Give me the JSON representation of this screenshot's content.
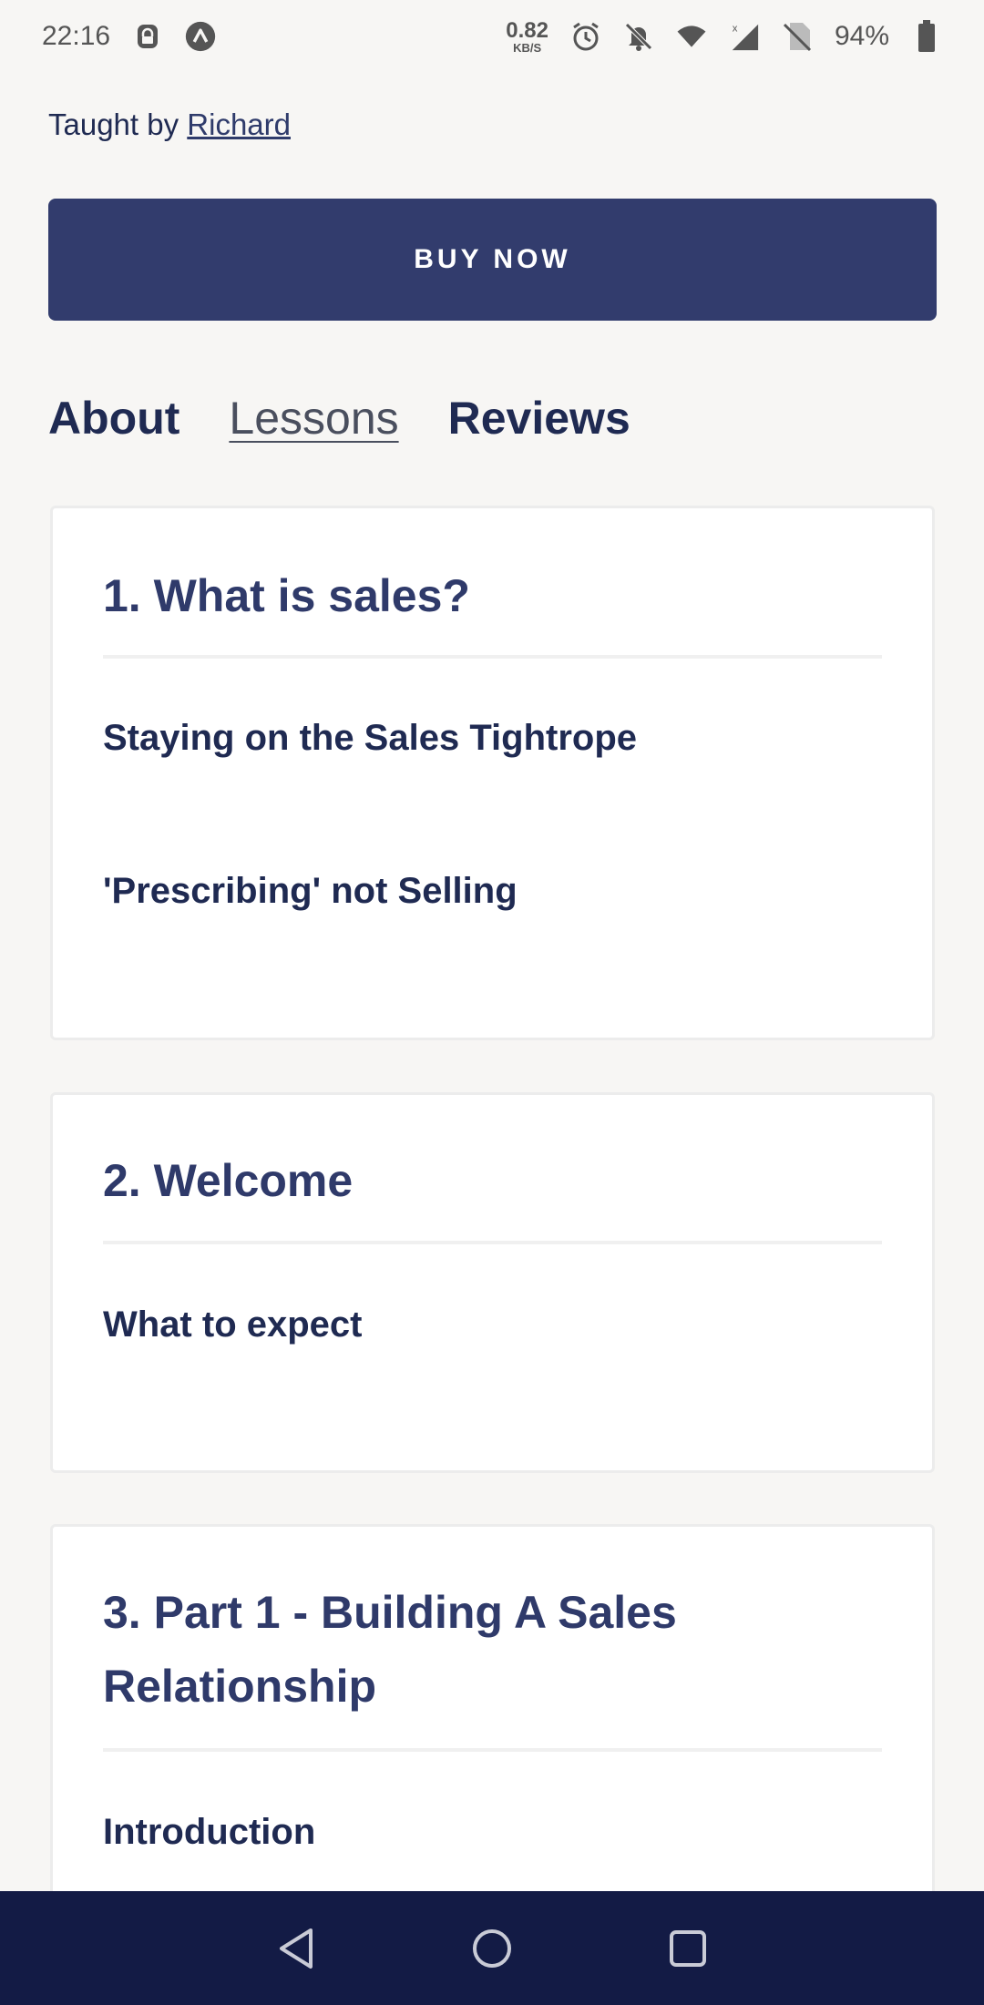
{
  "status_bar": {
    "time": "22:16",
    "net_speed_value": "0.82",
    "net_speed_unit": "KB/S",
    "battery": "94%"
  },
  "course": {
    "taught_by_prefix": "Taught by",
    "instructor": "Richard"
  },
  "buy_button": {
    "label": "BUY NOW"
  },
  "tabs": [
    {
      "label": "About",
      "active": false
    },
    {
      "label": "Lessons",
      "active": true
    },
    {
      "label": "Reviews",
      "active": false
    }
  ],
  "sections": [
    {
      "title": "1. What is sales?",
      "lessons": [
        "Staying on the Sales Tightrope",
        "'Prescribing' not Selling"
      ]
    },
    {
      "title": "2. Welcome",
      "lessons": [
        "What to expect"
      ]
    },
    {
      "title_line1": "3. Part 1 - Building A Sales",
      "title_line2": "Relationship",
      "lessons": [
        "Introduction"
      ]
    }
  ],
  "colors": {
    "primary": "#323c6d",
    "text": "#1f2a52",
    "nav_bar": "#131b45",
    "background": "#f7f6f4"
  }
}
